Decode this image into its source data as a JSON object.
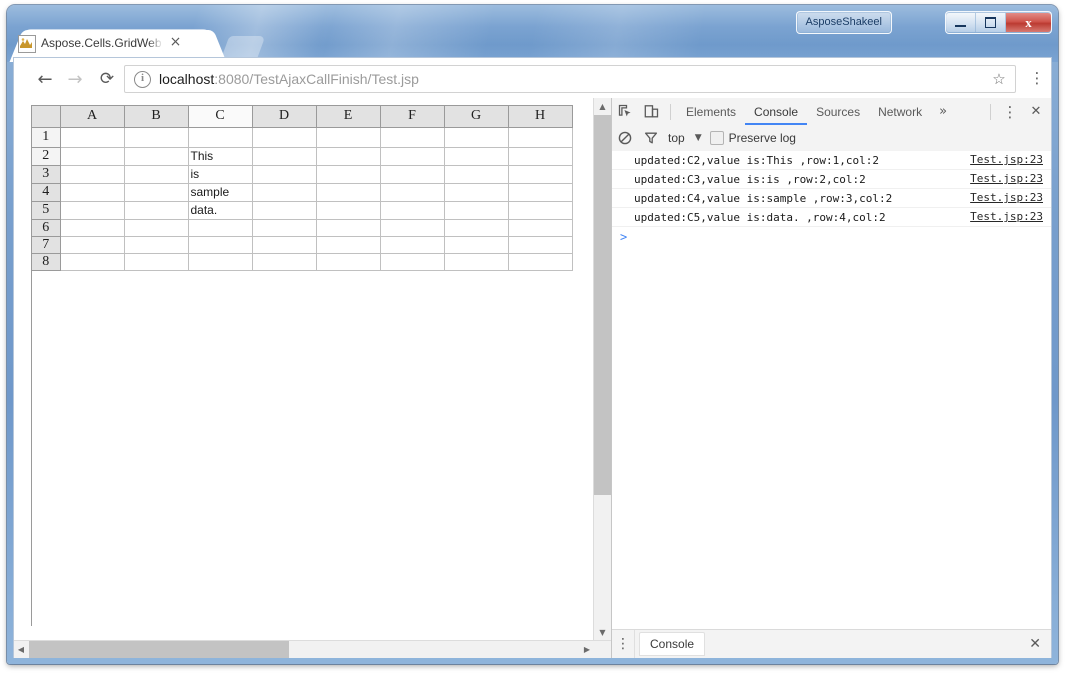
{
  "window": {
    "user_chip": "AsposeShakeel",
    "minimize_title": "Minimize",
    "maximize_title": "Maximize",
    "close_title": "Close"
  },
  "browser": {
    "tab": {
      "title": "Aspose.Cells.GridWeb for",
      "close_glyph": "×",
      "favicon_name": "aspose-favicon"
    },
    "toolbar": {
      "back_glyph": "←",
      "forward_glyph": "→",
      "reload_glyph": "⟳",
      "info_glyph": "i",
      "url_host": "localhost",
      "url_rest": ":8080/TestAjaxCallFinish/Test.jsp",
      "url_full": "localhost:8080/TestAjaxCallFinish/Test.jsp",
      "star_glyph": "☆",
      "menu_glyph": "⋮"
    }
  },
  "spreadsheet": {
    "columns": [
      "A",
      "B",
      "C",
      "D",
      "E",
      "F",
      "G",
      "H"
    ],
    "selected_column": "C",
    "selected_row": "2",
    "rows": [
      {
        "header": "1",
        "cells": [
          "",
          "",
          "",
          "",
          "",
          "",
          "",
          ""
        ]
      },
      {
        "header": "2",
        "cells": [
          "",
          "",
          "This",
          "",
          "",
          "",
          "",
          ""
        ]
      },
      {
        "header": "3",
        "cells": [
          "",
          "",
          "is",
          "",
          "",
          "",
          "",
          ""
        ]
      },
      {
        "header": "4",
        "cells": [
          "",
          "",
          "sample",
          "",
          "",
          "",
          "",
          ""
        ]
      },
      {
        "header": "5",
        "cells": [
          "",
          "",
          "data.",
          "",
          "",
          "",
          "",
          ""
        ]
      },
      {
        "header": "6",
        "cells": [
          "",
          "",
          "",
          "",
          "",
          "",
          "",
          ""
        ]
      },
      {
        "header": "7",
        "cells": [
          "",
          "",
          "",
          "",
          "",
          "",
          "",
          ""
        ]
      },
      {
        "header": "8",
        "cells": [
          "",
          "",
          "",
          "",
          "",
          "",
          "",
          ""
        ]
      }
    ]
  },
  "devtools": {
    "tabs": [
      {
        "label": "Elements",
        "active": false
      },
      {
        "label": "Console",
        "active": true
      },
      {
        "label": "Sources",
        "active": false
      },
      {
        "label": "Network",
        "active": false
      }
    ],
    "more_glyph": "»",
    "menu_glyph": "⋮",
    "close_glyph": "✕",
    "inspect_icon": "inspect-element-icon",
    "device_icon": "device-toolbar-icon",
    "toolbar": {
      "clear_icon": "clear-console-icon",
      "filter_icon": "filter-icon",
      "context": "top",
      "context_caret": "▼",
      "preserve_log_label": "Preserve log",
      "preserve_log_checked": false
    },
    "console_messages": [
      {
        "text": "updated:C2,value is:This ,row:1,col:2",
        "source": "Test.jsp:23"
      },
      {
        "text": "updated:C3,value is:is ,row:2,col:2",
        "source": "Test.jsp:23"
      },
      {
        "text": "updated:C4,value is:sample ,row:3,col:2",
        "source": "Test.jsp:23"
      },
      {
        "text": "updated:C5,value is:data. ,row:4,col:2",
        "source": "Test.jsp:23"
      }
    ],
    "prompt_glyph": ">",
    "drawer": {
      "menu_glyph": "⋮",
      "tab_label": "Console",
      "close_glyph": "✕"
    }
  },
  "colors": {
    "accent_blue": "#4285f4",
    "titlebar_blue": "#7ba3d1",
    "close_red": "#bb3b32",
    "grid_header": "#e2e2e2",
    "grid_line": "#c0c0c0"
  }
}
